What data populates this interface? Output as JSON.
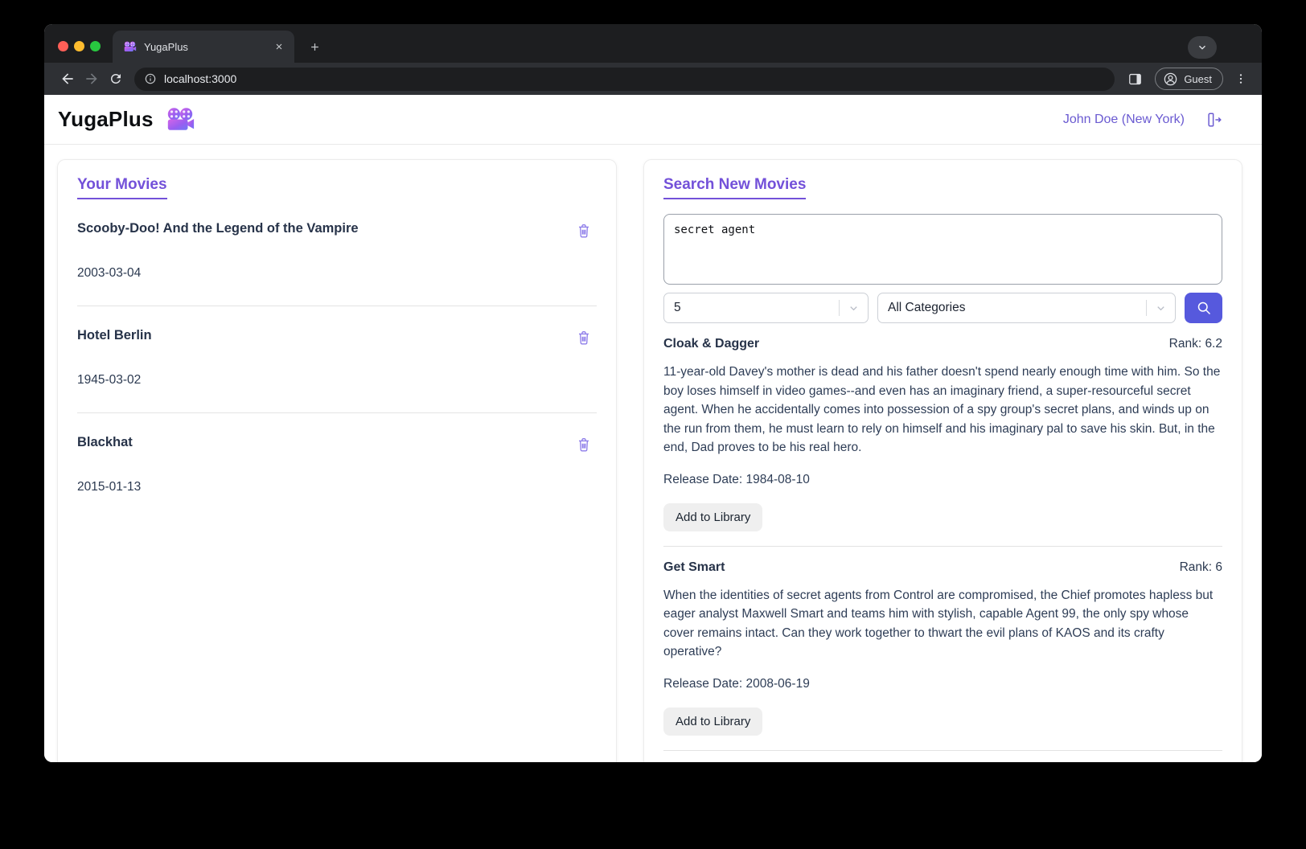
{
  "browser": {
    "tab_title": "YugaPlus",
    "url": "localhost:3000",
    "guest_label": "Guest"
  },
  "header": {
    "brand": "YugaPlus",
    "user": "John Doe (New York)"
  },
  "library": {
    "title": "Your Movies",
    "movies": [
      {
        "title": "Scooby-Doo! And the Legend of the Vampire",
        "date": "2003-03-04"
      },
      {
        "title": "Hotel Berlin",
        "date": "1945-03-02"
      },
      {
        "title": "Blackhat",
        "date": "2015-01-13"
      }
    ]
  },
  "search": {
    "title": "Search New Movies",
    "query": "secret agent",
    "limit": "5",
    "category": "All Categories",
    "add_label": "Add to Library",
    "results": [
      {
        "title": "Cloak & Dagger",
        "rank": "Rank: 6.2",
        "description": "11-year-old Davey's mother is dead and his father doesn't spend nearly enough time with him. So the boy loses himself in video games--and even has an imaginary friend, a super-resourceful secret agent. When he accidentally comes into possession of a spy group's secret plans, and winds up on the run from them, he must learn to rely on himself and his imaginary pal to save his skin. But, in the end, Dad proves to be his real hero.",
        "release": "Release Date: 1984-08-10"
      },
      {
        "title": "Get Smart",
        "rank": "Rank: 6",
        "description": "When the identities of secret agents from Control are compromised, the Chief promotes hapless but eager analyst Maxwell Smart and teams him with stylish, capable Agent 99, the only spy whose cover remains intact. Can they work together to thwart the evil plans of KAOS and its crafty operative?",
        "release": "Release Date: 2008-06-19"
      }
    ]
  },
  "colors": {
    "accent_purple": "#7351d9",
    "link_purple": "#6a5ad1",
    "icon_purple": "#8d7ce9",
    "search_button": "#5659dd"
  }
}
